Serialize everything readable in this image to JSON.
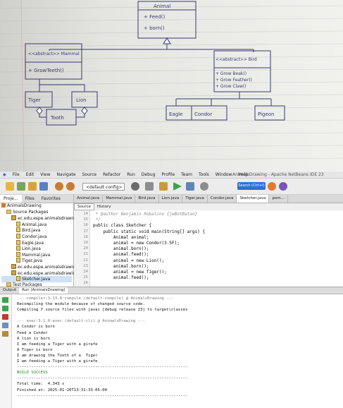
{
  "sketch": {
    "animal_box": {
      "title": "Animal",
      "methods": [
        "+ Feed()",
        "+ born()"
      ]
    },
    "mammal_box": {
      "title": "<<abstract>> Mammal",
      "methods": [
        "+ GrowTeeth()"
      ]
    },
    "bird_box": {
      "title": "<<abstract>> Bird",
      "methods": [
        "+ Grow Beak()",
        "+ Grow Feather()",
        "+ Grow Claw()"
      ]
    },
    "tiger_box": "Tiger",
    "lion_box": "Lion",
    "tooth_box": "Tooth",
    "eagle_box": "Eagle",
    "condor_box": "Condor",
    "pigeon_box": "Pigeon"
  },
  "menu": [
    "File",
    "Edit",
    "View",
    "Navigate",
    "Source",
    "Refactor",
    "Run",
    "Debug",
    "Profile",
    "Team",
    "Tools",
    "Window",
    "Help"
  ],
  "window_title": "AnimalsDrawing - Apache NetBeans IDE 23",
  "toolbar": {
    "config": "<default config>",
    "search": "Search (Ctrl+I)"
  },
  "left_tabs": [
    "Proje...",
    "Files",
    "Favorites"
  ],
  "tree": [
    {
      "label": "AnimalsDrawing",
      "icon": "proj",
      "indent": 0
    },
    {
      "label": "Source Packages",
      "icon": "fold",
      "indent": 1
    },
    {
      "label": "ec.edu.espe.animalsdrawing...",
      "icon": "pkg",
      "indent": 2
    },
    {
      "label": "Animal.java",
      "icon": "jf",
      "indent": 3
    },
    {
      "label": "Bird.java",
      "icon": "jf",
      "indent": 3
    },
    {
      "label": "Condor.java",
      "icon": "jf",
      "indent": 3
    },
    {
      "label": "Eagle.java",
      "icon": "jf",
      "indent": 3
    },
    {
      "label": "Lion.java",
      "icon": "jf",
      "indent": 3
    },
    {
      "label": "Mammal.java",
      "icon": "jf",
      "indent": 3
    },
    {
      "label": "Tiger.java",
      "icon": "jf",
      "indent": 3
    },
    {
      "label": "ec.edu.espe.animalsdrawing...",
      "icon": "pkg",
      "indent": 2
    },
    {
      "label": "ec.edu.espe.animalsdrawing...",
      "icon": "pkg",
      "indent": 2
    },
    {
      "label": "Sketcher.java",
      "icon": "jf",
      "indent": 3
    },
    {
      "label": "Test Packages",
      "icon": "fold",
      "indent": 1
    },
    {
      "label": "Dependencies",
      "icon": "fold",
      "indent": 1
    },
    {
      "label": "Java Dependencies",
      "icon": "fold",
      "indent": 1
    }
  ],
  "editor_tabs": [
    "Animal.java",
    "Mammal.java",
    "Bird.java",
    "Lion.java",
    "Tiger.java",
    "Condor.java",
    "Sketcher.java",
    "pom..."
  ],
  "active_editor_tab": "Sketcher.java",
  "subtabs": [
    "Source",
    "History"
  ],
  "code": [
    {
      "n": "14",
      "text": " * @author Benjamin Robalino {jeBotBatan}"
    },
    {
      "n": "15",
      "text": " */"
    },
    {
      "n": "16",
      "text": "public class Sketcher {"
    },
    {
      "n": "17",
      "text": "    public static void main(String[] args) {"
    },
    {
      "n": "18",
      "text": "        Animal animal;"
    },
    {
      "n": "19",
      "text": "        animal = new Condor(3.5F);"
    },
    {
      "n": "20",
      "text": "        animal.born();"
    },
    {
      "n": "21",
      "text": "        animal.feed();"
    },
    {
      "n": "22",
      "text": "        animal = new Lion();"
    },
    {
      "n": "23",
      "text": "        animal.born();"
    },
    {
      "n": "24",
      "text": "        animal = new Tiger();"
    },
    {
      "n": "25",
      "text": "        animal.feed();"
    },
    {
      "n": "26",
      "text": ""
    }
  ],
  "output_tabs": [
    "Output",
    "Run (AnimalsDrawing)"
  ],
  "output": [
    {
      "t": "--- compiler:3.13.0:compile (default-compile) @ AnimalsDrawing ---",
      "c": "dim"
    },
    {
      "t": "Recompiling the module because of changed source code.",
      "c": ""
    },
    {
      "t": "Compiling 7 source files with javac [debug release 23] to target\\classes",
      "c": ""
    },
    {
      "t": "",
      "c": ""
    },
    {
      "t": "--- exec:3.1.0:exec (default-cli) @ AnimalsDrawing ---",
      "c": "dim"
    },
    {
      "t": "A Condor is born",
      "c": ""
    },
    {
      "t": "Feed a Condor",
      "c": ""
    },
    {
      "t": "A lion is born",
      "c": ""
    },
    {
      "t": "I am feeding a Tiger with a girafe",
      "c": ""
    },
    {
      "t": "A Tiger is born",
      "c": ""
    },
    {
      "t": "I am drawing the Tooth of a  Tiger",
      "c": ""
    },
    {
      "t": "I am feeding a Tiger with a girafe",
      "c": ""
    },
    {
      "t": "------------------------------------------------------------------------",
      "c": ""
    },
    {
      "t": "BUILD SUCCESS",
      "c": "ok"
    },
    {
      "t": "------------------------------------------------------------------------",
      "c": ""
    },
    {
      "t": "Total time:  4.343 s",
      "c": ""
    },
    {
      "t": "Finished at: 2025-01-20T13:31:33-05:00",
      "c": ""
    },
    {
      "t": "------------------------------------------------------------------------",
      "c": ""
    }
  ]
}
